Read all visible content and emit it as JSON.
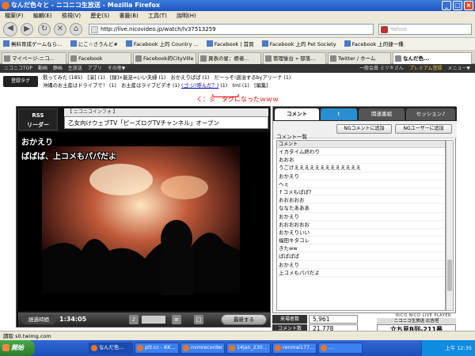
{
  "window": {
    "title": "なんだ色々と - ニコニコ生放送 - Mozilla Firefox",
    "btn_min": "_",
    "btn_max": "□",
    "btn_close": "×"
  },
  "menu": [
    "檔案(F)",
    "編輯(E)",
    "檢視(V)",
    "歷史(S)",
    "書籤(B)",
    "工具(T)",
    "說明(H)"
  ],
  "nav": {
    "url": "http://live.nicovideo.jp/watch/lv37513259",
    "search_placeholder": "Yahoo",
    "back": "◀",
    "forward": "▶",
    "reload": "↻",
    "stop": "✕",
    "home": "⌂"
  },
  "bookmarks": [
    "無料育成ゲームなら…",
    "にこ☆さうんど#",
    "Facebook 上的 Country ...",
    "Facebook | 首頁",
    "Facebook 上的 Pet Society",
    "Facebook 上的捷一種"
  ],
  "tabs": [
    "マイページ-ニコ...",
    "Facebook",
    "Facebook的CityVille",
    "異表の星：癒者...",
    "管理後台 » 部落...",
    "Twitter / ホーム",
    "なんだ色..."
  ],
  "nicobar": {
    "items": [
      "ニコニコTOP",
      "動画",
      "静画",
      "生放送",
      "アプリ",
      "その他▼"
    ],
    "right": "一般会員 ミツキさん",
    "premium": "プレミアム登録",
    "menu": "メニュー▼"
  },
  "tags": {
    "button": "登録タグ",
    "line1": "歌ってみた (185)　[演] (1)　[録]×能足=いい夫婦 (1)　おかえりぱぱ (1)　だーっそ!退治するbyアリーナ (1)",
    "line2": "沖縄のお土産はドライブで！ (1)　お土産はライブビデオ (1)",
    "highlight_tag": "(ゴ:ジ!呼んだ？)",
    "tail": "(1)　tml (1)　[編集]",
    "annotation": "く：彡　タグになったｗｗｗ"
  },
  "player": {
    "rss_line1": "RSS",
    "rss_line2": "リーダー",
    "info_head": "【 ニコニコインフォ 】",
    "info_title": "乙女向けウェブTV「ピーズログTVチャンネル」オープン",
    "overlay1": "おかえり",
    "overlay2": "ぱぱぱ、上コメもパパだよ",
    "elapsed_label": "経過時間",
    "elapsed": "1:34:05",
    "refresh": "最新する",
    "ctrl_sound": "SOUND",
    "ctrl_comment": "COMMENT",
    "ctrl_window": "WINDOW"
  },
  "comments_panel": {
    "tab_comment": "コメント",
    "tab_related": "関連番組",
    "tab_session": "セッション♪",
    "ng_comment": "NGコメントに追加",
    "ng_user": "NGユーザーに追加",
    "list_title": "コメント一覧",
    "header": "コメント",
    "items": [
      "イカタイム終わり",
      "おおお",
      "うごけえええええええええええええ",
      "おかえり",
      "へぇ",
      "↑コメもぱぱ？",
      "おおおおお",
      "ななたあああ",
      "おかえり",
      "おおおおおお",
      "おかえりいい",
      "福田キタコレ",
      "きたww",
      "ぱぱぱぱ",
      "おかえり",
      "上コメもパパだよ"
    ],
    "footer_logo": "NICO NICO LIVE PLAYER"
  },
  "stats": {
    "viewers_label": "来場者数",
    "viewers": "5,961",
    "comments_label": "コメント数",
    "comments": "21,778",
    "ad_head": "ニコニコ生放送 広告塔",
    "ad_text": "立ち見B列-211番"
  },
  "statusbar": "讀取 s0.twimg.com",
  "taskbar": {
    "start": "開始",
    "tasks": [
      "なんだ色...",
      "ptt.cc - KK...",
      "nvmrecorder",
      "14jan_230...",
      "renmai177...",
      "..."
    ],
    "clock": "上午 12:35"
  }
}
